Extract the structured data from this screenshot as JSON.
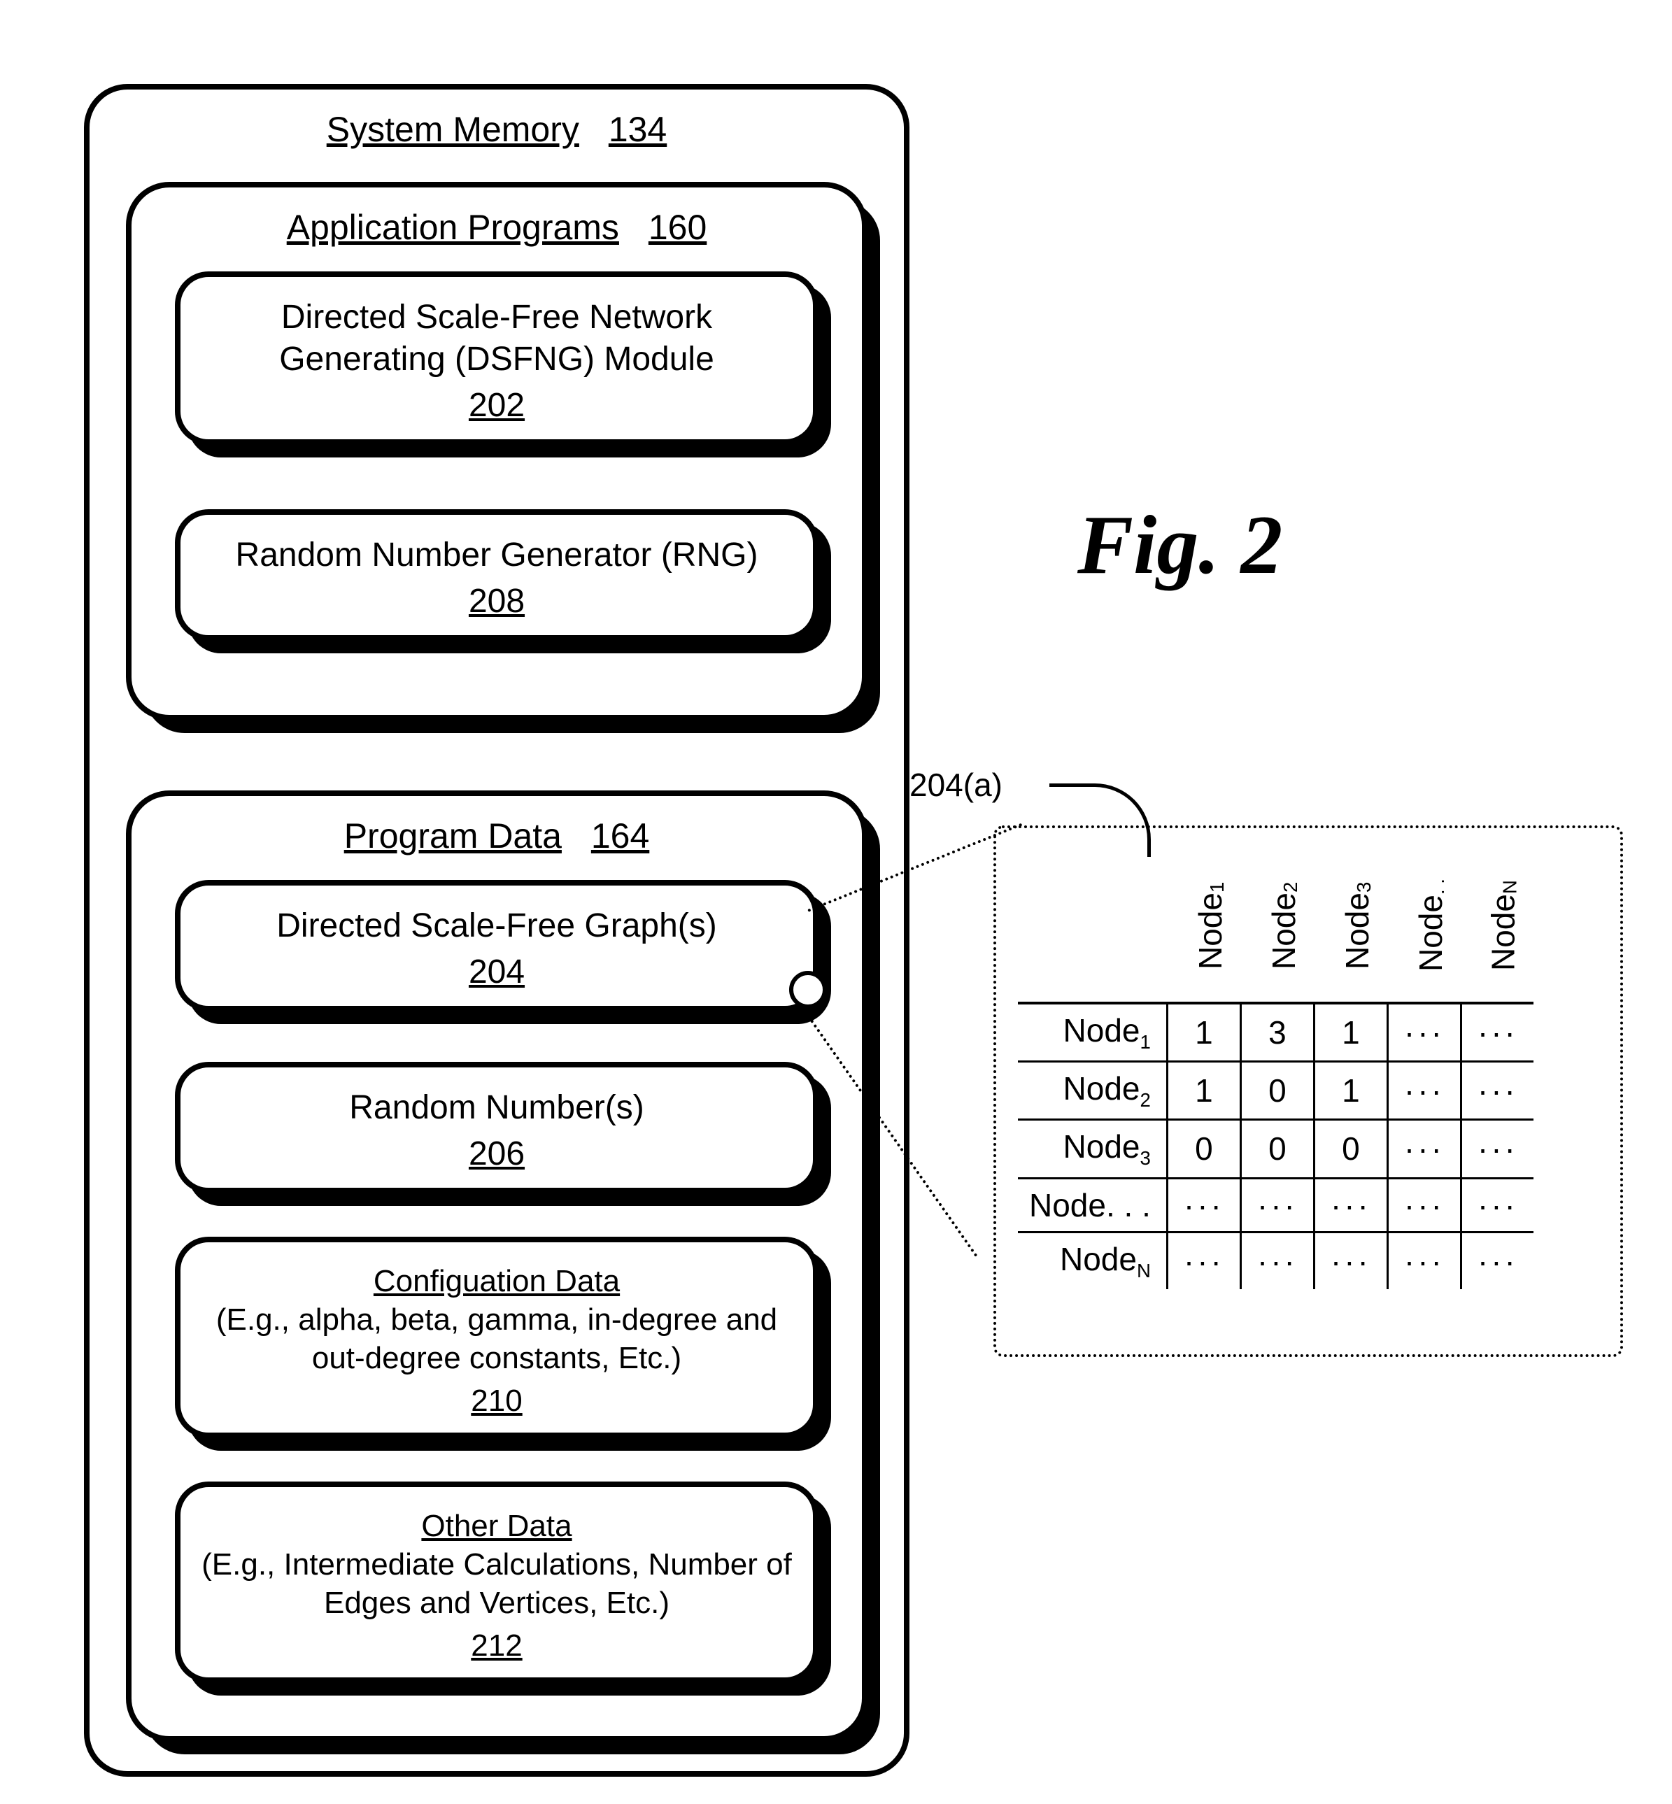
{
  "figure_caption": "Fig. 2",
  "system_memory": {
    "title": "System Memory",
    "num": "134"
  },
  "app_programs": {
    "title": "Application Programs",
    "num": "160",
    "items": [
      {
        "label": "Directed Scale-Free Network Generating (DSFNG) Module",
        "num": "202"
      },
      {
        "label": "Random Number Generator (RNG)",
        "num": "208"
      }
    ]
  },
  "program_data": {
    "title": "Program Data",
    "num": "164",
    "items": [
      {
        "label": "Directed Scale-Free Graph(s)",
        "num": "204"
      },
      {
        "label": "Random Number(s)",
        "num": "206"
      },
      {
        "title": "Configuation Data",
        "desc": "(E.g., alpha, beta, gamma, in-degree and out-degree constants, Etc.)",
        "num": "210"
      },
      {
        "title": "Other Data",
        "desc": "(E.g., Intermediate Calculations, Number of Edges and Vertices, Etc.)",
        "num": "212"
      }
    ]
  },
  "callout": {
    "label": "204(a)",
    "col_headers": [
      "Node₁",
      "Node₂",
      "Node₃",
      "Node . .",
      "Node_N"
    ],
    "rows": [
      {
        "h": "Node₁",
        "c": [
          "1",
          "3",
          "1",
          "···",
          "···"
        ]
      },
      {
        "h": "Node₂",
        "c": [
          "1",
          "0",
          "1",
          "···",
          "···"
        ]
      },
      {
        "h": "Node₃",
        "c": [
          "0",
          "0",
          "0",
          "···",
          "···"
        ]
      },
      {
        "h": "Node. . .",
        "c": [
          "···",
          "···",
          "···",
          "···",
          "···"
        ]
      },
      {
        "h": "Node_N",
        "c": [
          "···",
          "···",
          "···",
          "···",
          "···"
        ]
      }
    ]
  }
}
